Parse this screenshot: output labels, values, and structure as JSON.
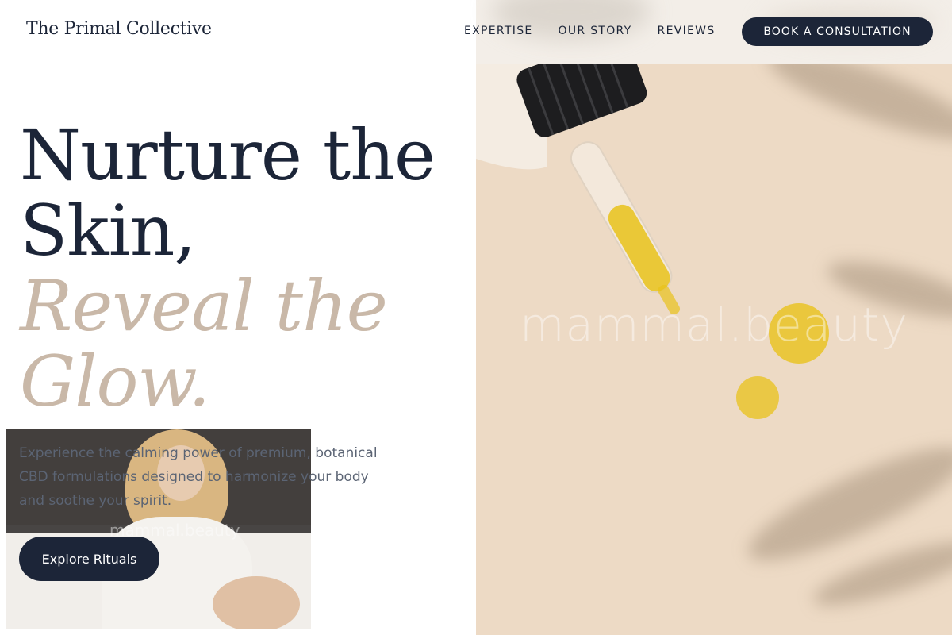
{
  "brand": {
    "logo_text": "The Primal Collective"
  },
  "nav": {
    "items": [
      {
        "label": "EXPERTISE"
      },
      {
        "label": "OUR STORY"
      },
      {
        "label": "REVIEWS"
      }
    ],
    "cta_label": "BOOK A CONSULTATION"
  },
  "hero": {
    "headline_line1": "Nurture the",
    "headline_line2": "Skin,",
    "headline_line3": "Reveal the",
    "headline_line4": "Glow.",
    "description": "Experience the calming power of premium, botanical CBD formulations designed to harmonize your body and soothe your spirit.",
    "button_label": "Explore Rituals"
  },
  "media": {
    "watermark": "mammal.beauty",
    "card_watermark": "mammal.beauty"
  },
  "colors": {
    "navy": "#1c2538",
    "accent_beige": "#c9b8a8",
    "photo_bg": "#eddac5",
    "oil_yellow": "#e8c21a"
  }
}
